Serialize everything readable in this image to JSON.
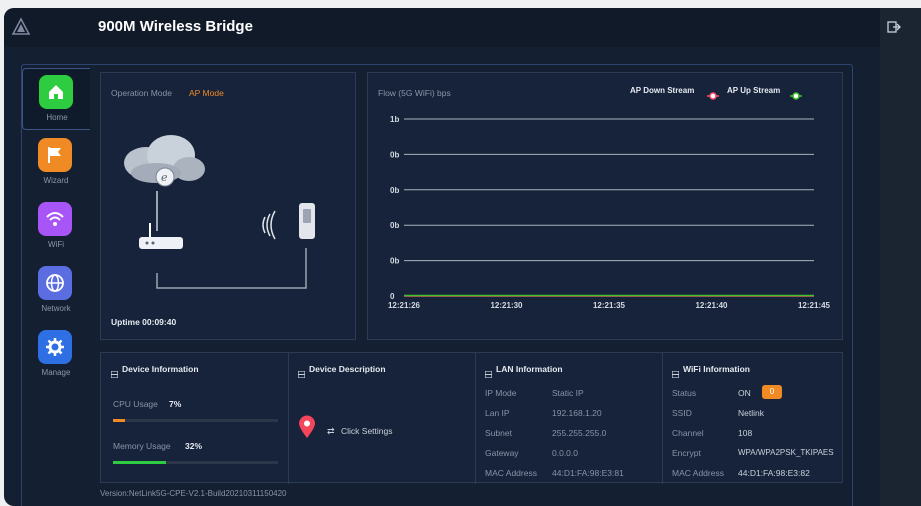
{
  "header": {
    "title": "900M Wireless Bridge"
  },
  "sidebar": {
    "items": [
      {
        "label": "Home",
        "icon": "home-icon",
        "color": "#2ecc40"
      },
      {
        "label": "Wizard",
        "icon": "flag-icon",
        "color": "#f08a24"
      },
      {
        "label": "WiFi",
        "icon": "wifi-icon",
        "color": "#a855f7"
      },
      {
        "label": "Network",
        "icon": "globe-icon",
        "color": "#5b6ee1"
      },
      {
        "label": "Manage",
        "icon": "gear-icon",
        "color": "#2f6fe4"
      }
    ]
  },
  "mode": {
    "label": "Operation Mode",
    "value": "AP Mode",
    "uptime": "Uptime 00:09:40"
  },
  "flow": {
    "title": "Flow (5G WiFi) bps",
    "legend_down": "AP Down Stream",
    "legend_up": "AP Up Stream"
  },
  "chart_data": {
    "type": "line",
    "title": "Flow (5G WiFi) bps",
    "x": [
      "12:21:26",
      "12:21:30",
      "12:21:35",
      "12:21:40",
      "12:21:45"
    ],
    "y_ticks": [
      "1b",
      "0b",
      "0b",
      "0b",
      "0b",
      "0"
    ],
    "series": [
      {
        "name": "AP Down Stream",
        "values": [
          0,
          0,
          0,
          0,
          0
        ],
        "color": "#ff4d6a"
      },
      {
        "name": "AP Up Stream",
        "values": [
          0,
          0,
          0,
          0,
          0
        ],
        "color": "#3ec12b"
      }
    ]
  },
  "device_info": {
    "title": "Device Information",
    "cpu_label": "CPU Usage",
    "cpu_value": "7%",
    "cpu_fraction": 0.07,
    "mem_label": "Memory Usage",
    "mem_value": "32%",
    "mem_fraction": 0.32
  },
  "device_desc": {
    "title": "Device Description",
    "link": "Click Settings"
  },
  "lan": {
    "title": "LAN Information",
    "rows": [
      {
        "k": "IP Mode",
        "v": "Static IP"
      },
      {
        "k": "Lan IP",
        "v": "192.168.1.20"
      },
      {
        "k": "Subnet",
        "v": "255.255.255.0"
      },
      {
        "k": "Gateway",
        "v": "0.0.0.0"
      },
      {
        "k": "MAC Address",
        "v": "44:D1:FA:98:E3:81"
      }
    ]
  },
  "wifi": {
    "title": "WiFi Information",
    "rows": [
      {
        "k": "Status",
        "v": "ON",
        "badge": "0"
      },
      {
        "k": "SSID",
        "v": "Netlink"
      },
      {
        "k": "Channel",
        "v": "108"
      },
      {
        "k": "Encrypt",
        "v": "WPA/WPA2PSK_TKIPAES"
      },
      {
        "k": "MAC Address",
        "v": "44:D1:FA:98:E3:82"
      }
    ]
  },
  "footer": {
    "version": "Version:NetLink5G-CPE-V2.1-Build20210311150420"
  },
  "colors": {
    "accent": "#f08a24",
    "bar_bg": "#2b3648",
    "mem_bar": "#2ecc40"
  }
}
